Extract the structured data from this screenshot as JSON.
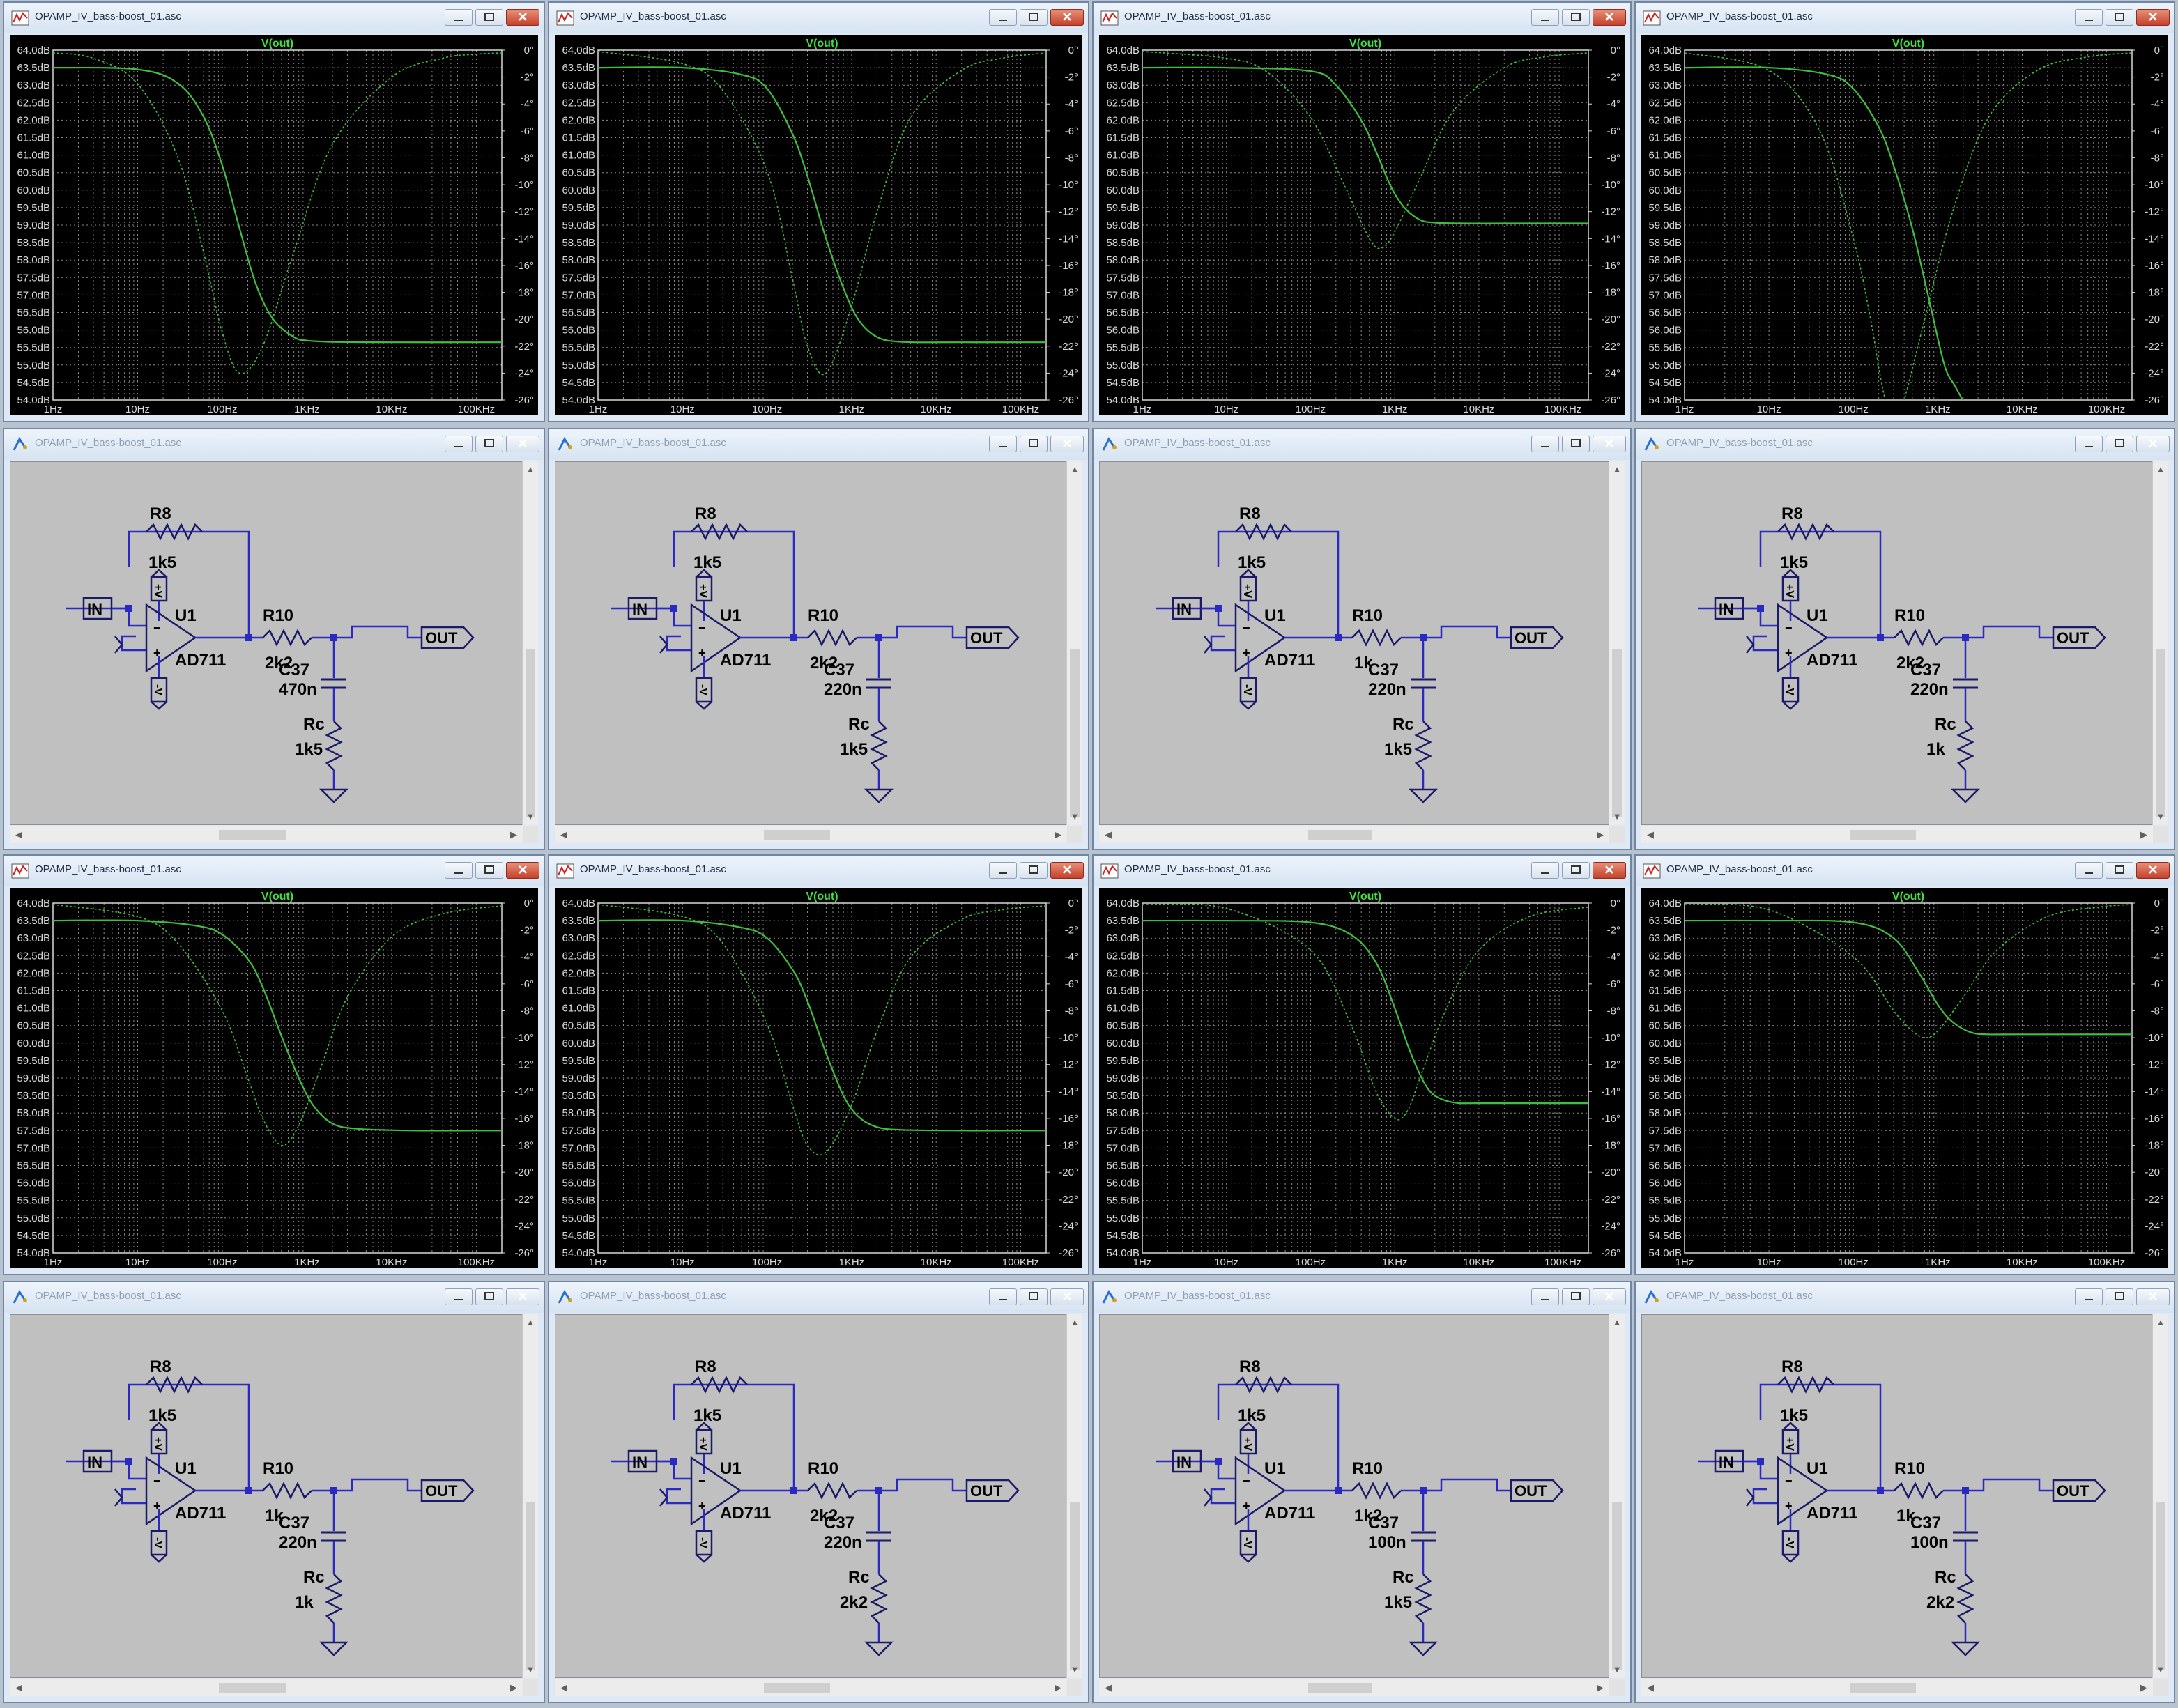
{
  "colors": {
    "plot_bg": "#000000",
    "grid": "#8a8a8a",
    "axis_text": "#d8d8d8",
    "trace": "#3fbe3f",
    "trace_title": "#3fe03f",
    "schematic_bg": "#c0c0c0",
    "wire": "#2a2ac0",
    "component": "#1a1a66",
    "label": "#000000"
  },
  "icons": {
    "plot_window": "waveform-icon",
    "schematic_window": "schematic-icon"
  },
  "window_title": "OPAMP_IV_bass-boost_01.asc",
  "axes": {
    "y_ticks": [
      "64.0dB",
      "63.5dB",
      "63.0dB",
      "62.5dB",
      "62.0dB",
      "61.5dB",
      "61.0dB",
      "60.5dB",
      "60.0dB",
      "59.5dB",
      "59.0dB",
      "58.5dB",
      "58.0dB",
      "57.5dB",
      "57.0dB",
      "56.5dB",
      "56.0dB",
      "55.5dB",
      "55.0dB",
      "54.5dB",
      "54.0dB"
    ],
    "phase_ticks": [
      "0°",
      "-2°",
      "-4°",
      "-6°",
      "-8°",
      "-10°",
      "-12°",
      "-14°",
      "-16°",
      "-18°",
      "-20°",
      "-22°",
      "-24°",
      "-26°"
    ],
    "x_ticks": [
      "1Hz",
      "10Hz",
      "100Hz",
      "1KHz",
      "10KHz",
      "100KHz"
    ]
  },
  "schematic_labels": {
    "r8_name": "R8",
    "r8_value": "1k5",
    "opamp_name": "U1",
    "opamp_model": "AD711",
    "r10_name": "R10",
    "c37_name": "C37",
    "rc_name": "Rc",
    "in_port": "IN",
    "out_port": "OUT",
    "plus_rail": "+V",
    "minus_rail": "-V"
  },
  "schematics": [
    {
      "r10": "2k2",
      "c37": "470n",
      "rc": "1k5"
    },
    {
      "r10": "2k2",
      "c37": "220n",
      "rc": "1k5"
    },
    {
      "r10": "1k",
      "c37": "220n",
      "rc": "1k5"
    },
    {
      "r10": "2k2",
      "c37": "220n",
      "rc": "1k"
    },
    {
      "r10": "1k",
      "c37": "220n",
      "rc": "1k"
    },
    {
      "r10": "2k2",
      "c37": "220n",
      "rc": "2k2"
    },
    {
      "r10": "1k2",
      "c37": "100n",
      "rc": "1k5"
    },
    {
      "r10": "1k",
      "c37": "100n",
      "rc": "2k2"
    }
  ],
  "chart_data": [
    {
      "type": "line",
      "title": "V(out)",
      "xscale": "log",
      "xlim": [
        1,
        200000
      ],
      "ylim_db": [
        54.0,
        64.0
      ],
      "phase_lim_deg": [
        -26,
        0
      ],
      "series": [
        {
          "name": "magnitude",
          "unit": "dB",
          "x": [
            1,
            10,
            30,
            60,
            100,
            160,
            250,
            400,
            700,
            1000,
            2000,
            10000,
            100000,
            200000
          ],
          "y": [
            63.5,
            63.45,
            63.05,
            62.1,
            60.7,
            58.9,
            57.3,
            56.3,
            55.8,
            55.7,
            55.66,
            55.65,
            55.65,
            55.65
          ]
        },
        {
          "name": "phase",
          "unit": "deg",
          "x": [
            1,
            3,
            10,
            30,
            60,
            100,
            160,
            300,
            700,
            2000,
            10000,
            40000,
            100000,
            200000
          ],
          "y": [
            -0.2,
            -0.6,
            -2.5,
            -8,
            -15,
            -21,
            -24,
            -22,
            -15,
            -7,
            -2,
            -0.6,
            -0.3,
            -0.2
          ]
        }
      ]
    },
    {
      "type": "line",
      "title": "V(out)",
      "xscale": "log",
      "xlim": [
        1,
        200000
      ],
      "ylim_db": [
        54.0,
        64.0
      ],
      "phase_lim_deg": [
        -26,
        0
      ],
      "series": [
        {
          "name": "magnitude",
          "unit": "dB",
          "x": [
            1,
            10,
            50,
            100,
            200,
            300,
            500,
            800,
            1200,
            2000,
            4000,
            20000,
            100000,
            200000
          ],
          "y": [
            63.5,
            63.5,
            63.3,
            62.9,
            61.6,
            60.4,
            58.6,
            57.2,
            56.3,
            55.8,
            55.66,
            55.65,
            55.65,
            55.65
          ]
        },
        {
          "name": "phase",
          "unit": "deg",
          "x": [
            1,
            10,
            30,
            100,
            200,
            300,
            500,
            1000,
            2000,
            5000,
            20000,
            60000,
            200000
          ],
          "y": [
            -0.1,
            -1,
            -3,
            -9,
            -17,
            -22,
            -24,
            -19,
            -12,
            -5,
            -1.5,
            -0.6,
            -0.2
          ]
        }
      ]
    },
    {
      "type": "line",
      "title": "V(out)",
      "xscale": "log",
      "xlim": [
        1,
        200000
      ],
      "ylim_db": [
        54.0,
        64.0
      ],
      "phase_lim_deg": [
        -26,
        0
      ],
      "series": [
        {
          "name": "magnitude",
          "unit": "dB",
          "x": [
            1,
            10,
            100,
            200,
            400,
            600,
            900,
            1300,
            2000,
            3000,
            6000,
            20000,
            100000,
            200000
          ],
          "y": [
            63.5,
            63.5,
            63.4,
            63.0,
            62.0,
            61.1,
            60.1,
            59.5,
            59.15,
            59.07,
            59.05,
            59.05,
            59.05,
            59.05
          ]
        },
        {
          "name": "phase",
          "unit": "deg",
          "x": [
            1,
            10,
            30,
            100,
            250,
            500,
            700,
            1000,
            2000,
            5000,
            20000,
            60000,
            200000
          ],
          "y": [
            -0.1,
            -0.6,
            -1.6,
            -5,
            -10,
            -14,
            -14.7,
            -13.5,
            -9.5,
            -4.5,
            -1.3,
            -0.5,
            -0.2
          ]
        }
      ]
    },
    {
      "type": "line",
      "title": "V(out)",
      "xscale": "log",
      "xlim": [
        1,
        200000
      ],
      "ylim_db": [
        54.0,
        64.0
      ],
      "phase_lim_deg": [
        -26,
        0
      ],
      "series": [
        {
          "name": "magnitude",
          "unit": "dB",
          "x": [
            1,
            10,
            50,
            100,
            200,
            300,
            500,
            800,
            1200,
            1600,
            2200
          ],
          "y": [
            63.5,
            63.5,
            63.3,
            62.9,
            61.8,
            60.7,
            58.9,
            56.8,
            55.0,
            54.4,
            53.8
          ]
        },
        {
          "name": "phase",
          "unit": "deg",
          "x": [
            1,
            10,
            40,
            100,
            160,
            220,
            300,
            400,
            700,
            1500,
            4000,
            15000,
            60000,
            200000
          ],
          "y": [
            -0.2,
            -1.5,
            -6,
            -14,
            -20,
            -25,
            -28,
            -26,
            -20,
            -12,
            -5,
            -1.5,
            -0.5,
            -0.2
          ]
        }
      ]
    },
    {
      "type": "line",
      "title": "V(out)",
      "xscale": "log",
      "xlim": [
        1,
        200000
      ],
      "ylim_db": [
        54.0,
        64.0
      ],
      "phase_lim_deg": [
        -26,
        0
      ],
      "series": [
        {
          "name": "magnitude",
          "unit": "dB",
          "x": [
            1,
            10,
            50,
            100,
            200,
            300,
            500,
            800,
            1200,
            2000,
            4000,
            20000,
            100000,
            200000
          ],
          "y": [
            63.5,
            63.5,
            63.35,
            63.1,
            62.4,
            61.6,
            60.2,
            59.0,
            58.2,
            57.7,
            57.55,
            57.5,
            57.5,
            57.5
          ]
        },
        {
          "name": "phase",
          "unit": "deg",
          "x": [
            1,
            10,
            30,
            100,
            200,
            300,
            500,
            800,
            1500,
            3000,
            10000,
            40000,
            200000
          ],
          "y": [
            -0.1,
            -1,
            -3,
            -8,
            -13,
            -16,
            -18,
            -16.5,
            -12,
            -7,
            -2.5,
            -0.8,
            -0.2
          ]
        }
      ]
    },
    {
      "type": "line",
      "title": "V(out)",
      "xscale": "log",
      "xlim": [
        1,
        200000
      ],
      "ylim_db": [
        54.0,
        64.0
      ],
      "phase_lim_deg": [
        -26,
        0
      ],
      "series": [
        {
          "name": "magnitude",
          "unit": "dB",
          "x": [
            1,
            10,
            50,
            100,
            200,
            300,
            500,
            800,
            1200,
            2000,
            4000,
            20000,
            100000,
            200000
          ],
          "y": [
            63.5,
            63.5,
            63.3,
            63.0,
            62.1,
            61.2,
            59.7,
            58.5,
            57.9,
            57.6,
            57.52,
            57.5,
            57.5,
            57.5
          ]
        },
        {
          "name": "phase",
          "unit": "deg",
          "x": [
            1,
            10,
            30,
            100,
            200,
            300,
            500,
            1000,
            2000,
            5000,
            20000,
            60000,
            200000
          ],
          "y": [
            -0.1,
            -1,
            -3,
            -9,
            -15,
            -18,
            -18.5,
            -15,
            -9.5,
            -4,
            -1.2,
            -0.5,
            -0.2
          ]
        }
      ]
    },
    {
      "type": "line",
      "title": "V(out)",
      "xscale": "log",
      "xlim": [
        1,
        200000
      ],
      "ylim_db": [
        54.0,
        64.0
      ],
      "phase_lim_deg": [
        -26,
        0
      ],
      "series": [
        {
          "name": "magnitude",
          "unit": "dB",
          "x": [
            1,
            10,
            100,
            300,
            600,
            1000,
            1500,
            2200,
            3000,
            5000,
            10000,
            50000,
            200000
          ],
          "y": [
            63.5,
            63.5,
            63.45,
            63.1,
            62.3,
            61.0,
            59.8,
            58.9,
            58.5,
            58.3,
            58.28,
            58.28,
            58.28
          ]
        },
        {
          "name": "phase",
          "unit": "deg",
          "x": [
            1,
            10,
            100,
            300,
            600,
            1000,
            1400,
            2000,
            4000,
            10000,
            40000,
            200000
          ],
          "y": [
            -0.1,
            -0.4,
            -3.5,
            -9,
            -14,
            -16,
            -15.5,
            -13,
            -8,
            -3.5,
            -1,
            -0.3
          ]
        }
      ]
    },
    {
      "type": "line",
      "title": "V(out)",
      "xscale": "log",
      "xlim": [
        1,
        200000
      ],
      "ylim_db": [
        54.0,
        64.0
      ],
      "phase_lim_deg": [
        -26,
        0
      ],
      "series": [
        {
          "name": "magnitude",
          "unit": "dB",
          "x": [
            1,
            10,
            100,
            300,
            600,
            1000,
            1500,
            2500,
            4000,
            8000,
            30000,
            100000,
            200000
          ],
          "y": [
            63.5,
            63.5,
            63.45,
            63.0,
            62.0,
            61.1,
            60.6,
            60.3,
            60.25,
            60.25,
            60.25,
            60.25,
            60.25
          ]
        },
        {
          "name": "phase",
          "unit": "deg",
          "x": [
            1,
            10,
            100,
            300,
            500,
            700,
            1000,
            2000,
            5000,
            20000,
            80000,
            200000
          ],
          "y": [
            -0.1,
            -0.5,
            -4,
            -8,
            -9.5,
            -10,
            -9.5,
            -7,
            -3.5,
            -1,
            -0.3,
            -0.1
          ]
        }
      ]
    }
  ]
}
